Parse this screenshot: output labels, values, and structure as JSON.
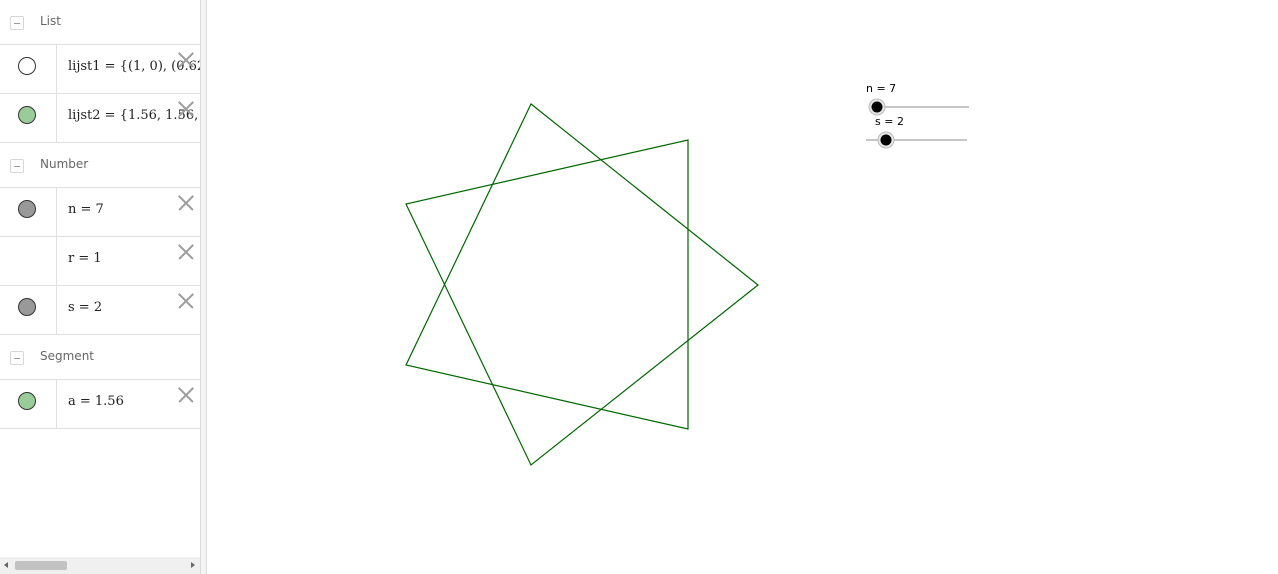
{
  "algebra": {
    "groups": [
      {
        "label": "List",
        "items": [
          {
            "text": "lijst1 = {(1, 0), (0.62,",
            "marble_fill": "#ffffff"
          },
          {
            "text": "lijst2 = {1.56, 1.56, 1.5",
            "marble_fill": "#99cc99"
          }
        ]
      },
      {
        "label": "Number",
        "items": [
          {
            "text": "n = 7",
            "marble_fill": "#999999"
          },
          {
            "text": "r = 1",
            "marble_fill": null
          },
          {
            "text": "s = 2",
            "marble_fill": "#999999"
          }
        ]
      },
      {
        "label": "Segment",
        "items": [
          {
            "text": "a = 1.56",
            "marble_fill": "#99cc99"
          }
        ]
      }
    ]
  },
  "graphics": {
    "shape_color": "#006600",
    "sliders": [
      {
        "label": "n = 7",
        "value": 7
      },
      {
        "label": "s = 2",
        "value": 2
      }
    ]
  }
}
